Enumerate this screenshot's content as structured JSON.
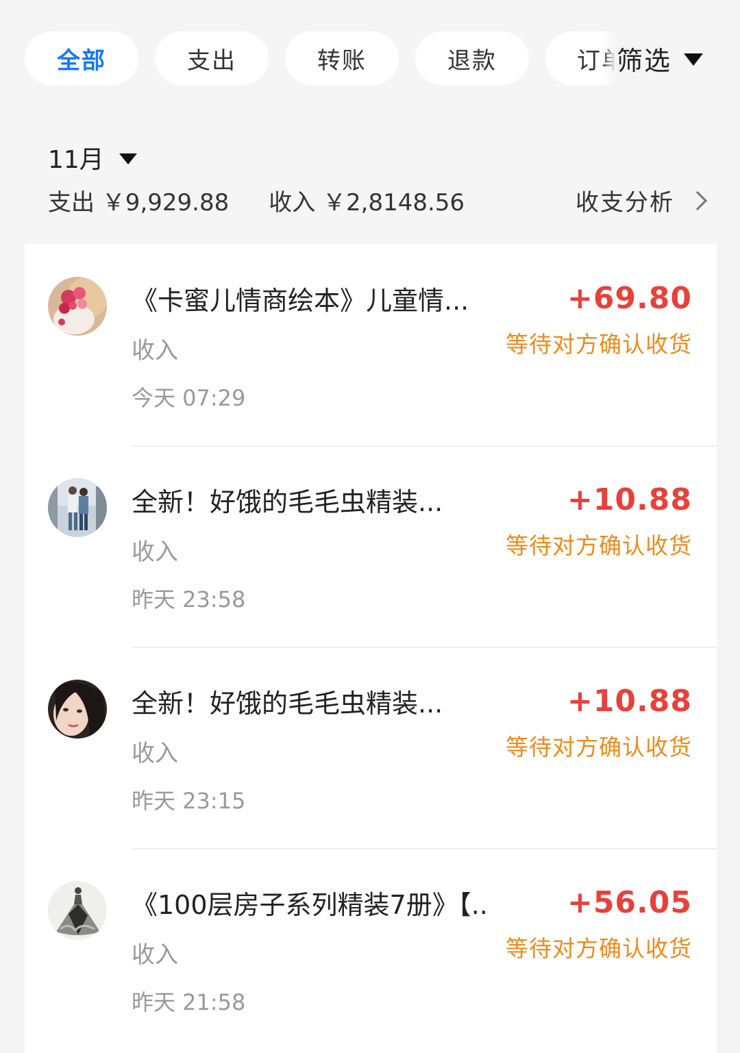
{
  "tabs": [
    {
      "label": "全部",
      "active": true
    },
    {
      "label": "支出",
      "active": false
    },
    {
      "label": "转账",
      "active": false
    },
    {
      "label": "退款",
      "active": false
    },
    {
      "label": "订单",
      "active": false
    }
  ],
  "filter": {
    "label": "筛选"
  },
  "month": {
    "label": "11月"
  },
  "summary": {
    "expense": "支出 ￥9,929.88",
    "income": "收入 ￥2,8148.56",
    "analysis": "收支分析"
  },
  "transactions": [
    {
      "title": "《卡蜜儿情商绘本》儿童情...",
      "kind": "收入",
      "time": "今天 07:29",
      "amount": "+69.80",
      "status": "等待对方确认收货",
      "avatar_icon": "flower-cake-avatar"
    },
    {
      "title": "全新！好饿的毛毛虫精装...",
      "kind": "收入",
      "time": "昨天 23:58",
      "amount": "+10.88",
      "status": "等待对方确认收货",
      "avatar_icon": "couple-avatar"
    },
    {
      "title": "全新！好饿的毛毛虫精装...",
      "kind": "收入",
      "time": "昨天 23:15",
      "amount": "+10.88",
      "status": "等待对方确认收货",
      "avatar_icon": "girl-portrait-avatar"
    },
    {
      "title": "《100层房子系列精装7册》【...",
      "kind": "收入",
      "time": "昨天 21:58",
      "amount": "+56.05",
      "status": "等待对方确认收货",
      "avatar_icon": "dress-sketch-avatar"
    }
  ],
  "colors": {
    "accent": "#1677ff",
    "amount": "#e8413b",
    "status": "#ef8a1a",
    "background": "#f5f5f5"
  }
}
